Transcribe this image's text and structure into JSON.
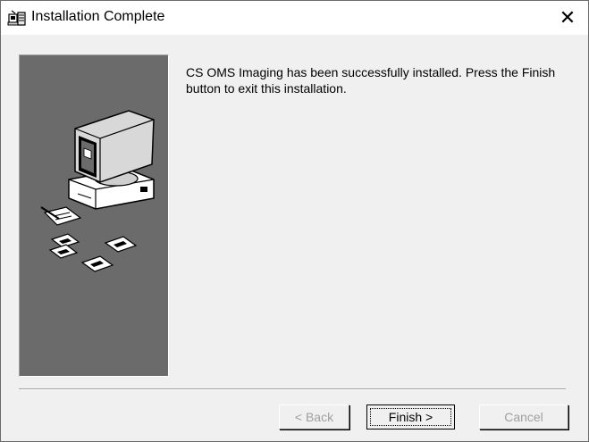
{
  "window": {
    "title": "Installation Complete",
    "close_glyph": "✕",
    "title_icon": "setup-icon"
  },
  "side_panel": {
    "illustration": "computer-with-disks"
  },
  "message": "CS OMS Imaging has been successfully installed.  Press the Finish button to exit this installation.",
  "buttons": {
    "back": {
      "label": "< Back",
      "enabled": false
    },
    "finish": {
      "label": "Finish >",
      "enabled": true,
      "default": true
    },
    "cancel": {
      "label": "Cancel",
      "enabled": false
    }
  },
  "colors": {
    "panel_bg": "#6b6b6b",
    "dialog_bg": "#f0f0f0",
    "titlebar_bg": "#ffffff"
  }
}
